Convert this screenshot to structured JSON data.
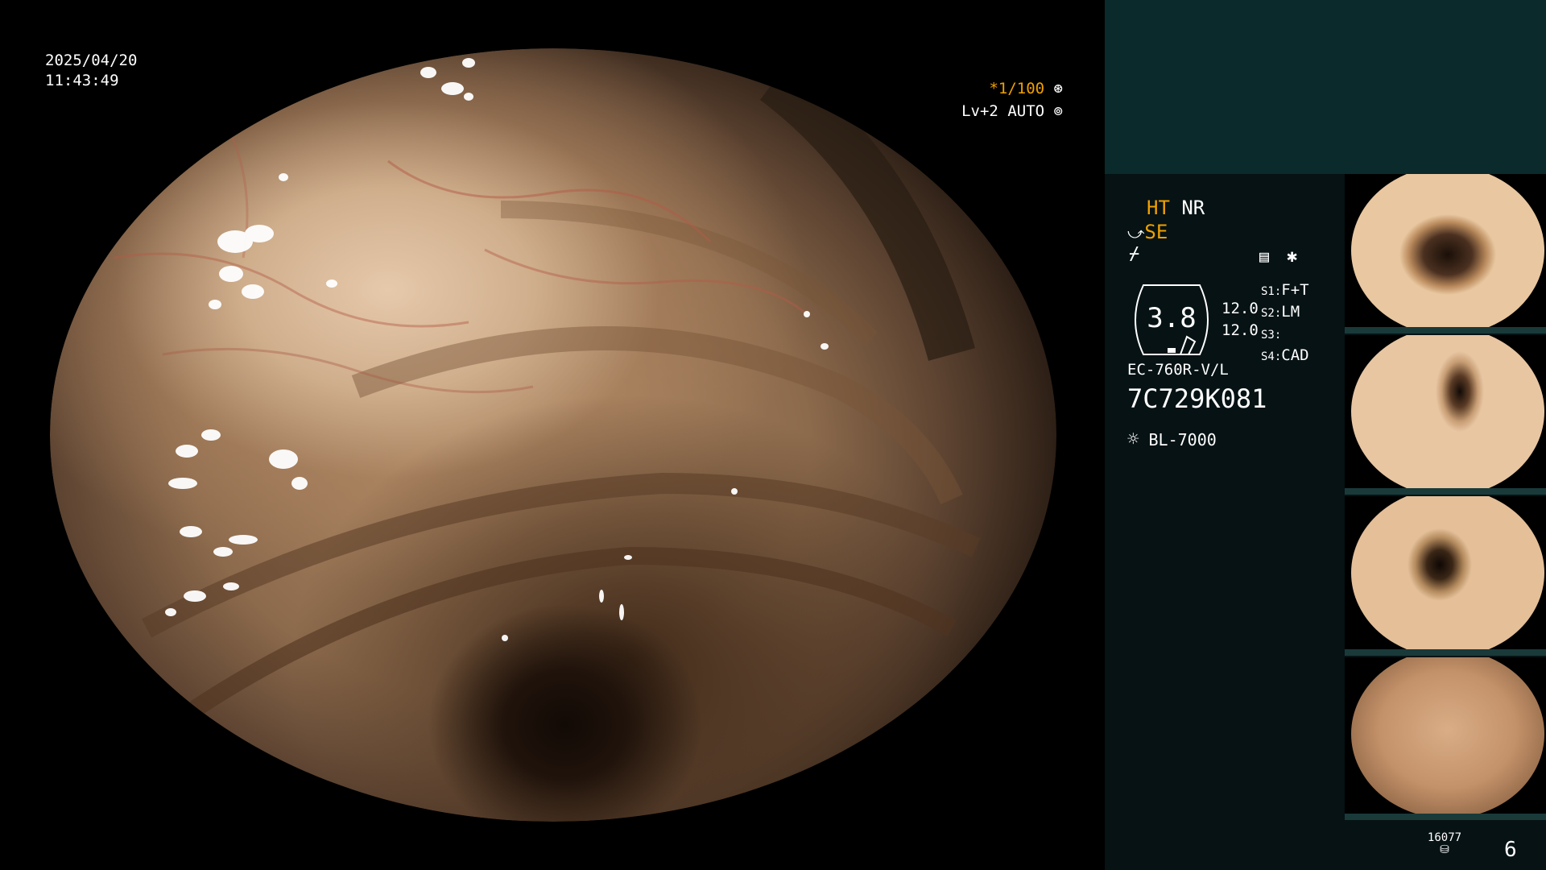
{
  "overlay": {
    "date": "2025/04/20",
    "time": "11:43:49",
    "shutter": "*1/100",
    "level": "Lv+2",
    "mode": "AUTO"
  },
  "panel": {
    "ht": "HT",
    "nr": "NR",
    "se": "SE",
    "gauge_value": "3.8",
    "scale_top": "12.0",
    "scale_bottom": "12.0",
    "settings": [
      {
        "key": "S1:",
        "value": "F+T"
      },
      {
        "key": "S2:",
        "value": "LM"
      },
      {
        "key": "S3:",
        "value": ""
      },
      {
        "key": "S4:",
        "value": "CAD"
      }
    ],
    "scope_model": "EC-760R-V/L",
    "scope_serial": "7C729K081",
    "light_source": "BL-7000",
    "storage_count": "16077",
    "image_count": "6"
  },
  "thumbnails": [
    {
      "tint": "#b98a5c"
    },
    {
      "tint": "#c79d74"
    },
    {
      "tint": "#b38a5d"
    },
    {
      "tint": "#d4a57c"
    }
  ],
  "colors": {
    "accent": "#f0a000",
    "panel_bg": "#061214",
    "panel_top": "#0b2a2c"
  }
}
